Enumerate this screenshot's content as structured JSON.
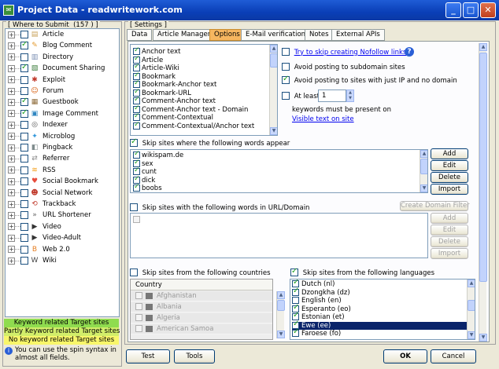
{
  "window": {
    "title": "Project Data - readwritework.com"
  },
  "sidebar": {
    "group_title": "Where to Submit",
    "count": "(157 )",
    "items": [
      {
        "label": "Article",
        "checked": false
      },
      {
        "label": "Blog Comment",
        "checked": true
      },
      {
        "label": "Directory",
        "checked": false
      },
      {
        "label": "Document Sharing",
        "checked": true
      },
      {
        "label": "Exploit",
        "checked": false
      },
      {
        "label": "Forum",
        "checked": false
      },
      {
        "label": "Guestbook",
        "checked": true
      },
      {
        "label": "Image Comment",
        "checked": true
      },
      {
        "label": "Indexer",
        "checked": false
      },
      {
        "label": "Microblog",
        "checked": false
      },
      {
        "label": "Pingback",
        "checked": false
      },
      {
        "label": "Referrer",
        "checked": false
      },
      {
        "label": "RSS",
        "checked": false
      },
      {
        "label": "Social Bookmark",
        "checked": false
      },
      {
        "label": "Social Network",
        "checked": false
      },
      {
        "label": "Trackback",
        "checked": false
      },
      {
        "label": "URL Shortener",
        "checked": false
      },
      {
        "label": "Video",
        "checked": false
      },
      {
        "label": "Video-Adult",
        "checked": false
      },
      {
        "label": "Web 2.0",
        "checked": false
      },
      {
        "label": "Wiki",
        "checked": false
      }
    ],
    "legend": {
      "keyword": "Keyword related Target sites",
      "partly": "Partly Keyword related Target sites",
      "no_keyword": "No keyword related Target sites"
    },
    "hint": "You can use the spin syntax in almost all fields.",
    "colors": {
      "keyword": "#8fdc4f",
      "partly": "#d2ee6a",
      "no_keyword": "#f8f66a"
    }
  },
  "settings": {
    "group_title": "Settings",
    "tabs": [
      "Data",
      "Article Manager",
      "Options",
      "E-Mail verification",
      "Notes",
      "External APIs"
    ],
    "active_tab": "Options",
    "type_list": [
      "Anchor text",
      "Article",
      "Article-Wiki",
      "Bookmark",
      "Bookmark-Anchor text",
      "Bookmark-URL",
      "Comment-Anchor text",
      "Comment-Anchor text - Domain",
      "Comment-Contextual",
      "Comment-Contextual/Anchor text"
    ],
    "options": {
      "nofollow_link": "Try to skip creating Nofollow links",
      "avoid_subdomain": "Avoid posting to subdomain sites",
      "avoid_ip": "Avoid posting to sites with just IP and no domain",
      "at_least_label": "At least",
      "at_least_value": "1",
      "keywords_text": "keywords must be present on",
      "visible_text_link": "Visible text on site"
    },
    "skip_words": {
      "label": "Skip sites where the following words appear",
      "checked": true,
      "words": [
        "wikispam.de",
        "sex",
        "cunt",
        "dick",
        "boobs"
      ],
      "buttons": {
        "add": "Add",
        "edit": "Edit",
        "delete": "Delete",
        "import": "Import"
      }
    },
    "skip_url": {
      "label": "Skip sites with the following words in URL/Domain",
      "checked": false,
      "create_filter": "Create Domain Filter",
      "buttons": {
        "add": "Add",
        "edit": "Edit",
        "delete": "Delete",
        "import": "Import"
      }
    },
    "skip_countries": {
      "label": "Skip sites from the following countries",
      "checked": false,
      "column": "Country",
      "countries": [
        "Afghanistan",
        "Albania",
        "Algeria",
        "American Samoa"
      ]
    },
    "skip_languages": {
      "label": "Skip sites from the following languages",
      "checked": true,
      "languages": [
        {
          "name": "Dutch (nl)",
          "checked": true
        },
        {
          "name": "Dzongkha (dz)",
          "checked": true
        },
        {
          "name": "English (en)",
          "checked": false
        },
        {
          "name": "Esperanto (eo)",
          "checked": true
        },
        {
          "name": "Estonian (et)",
          "checked": true
        },
        {
          "name": "Ewe (ee)",
          "checked": true
        },
        {
          "name": "Faroese (fo)",
          "checked": true
        }
      ],
      "selected": "Ewe (ee)"
    }
  },
  "footer": {
    "test": "Test",
    "tools": "Tools",
    "ok": "OK",
    "cancel": "Cancel"
  }
}
